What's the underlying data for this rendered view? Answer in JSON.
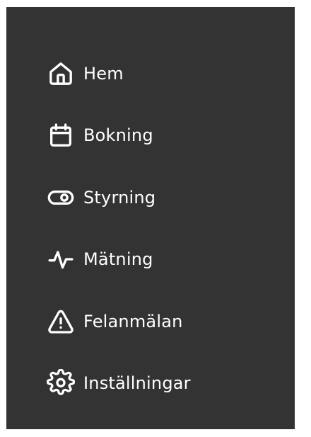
{
  "menu": {
    "background": "#333333",
    "text_color": "#ffffff",
    "items": [
      {
        "label": "Hem",
        "icon": "home-icon"
      },
      {
        "label": "Bokning",
        "icon": "calendar-icon"
      },
      {
        "label": "Styrning",
        "icon": "toggle-icon"
      },
      {
        "label": "Mätning",
        "icon": "activity-icon"
      },
      {
        "label": "Felanmälan",
        "icon": "warning-icon"
      },
      {
        "label": "Inställningar",
        "icon": "settings-gear-icon"
      }
    ]
  }
}
